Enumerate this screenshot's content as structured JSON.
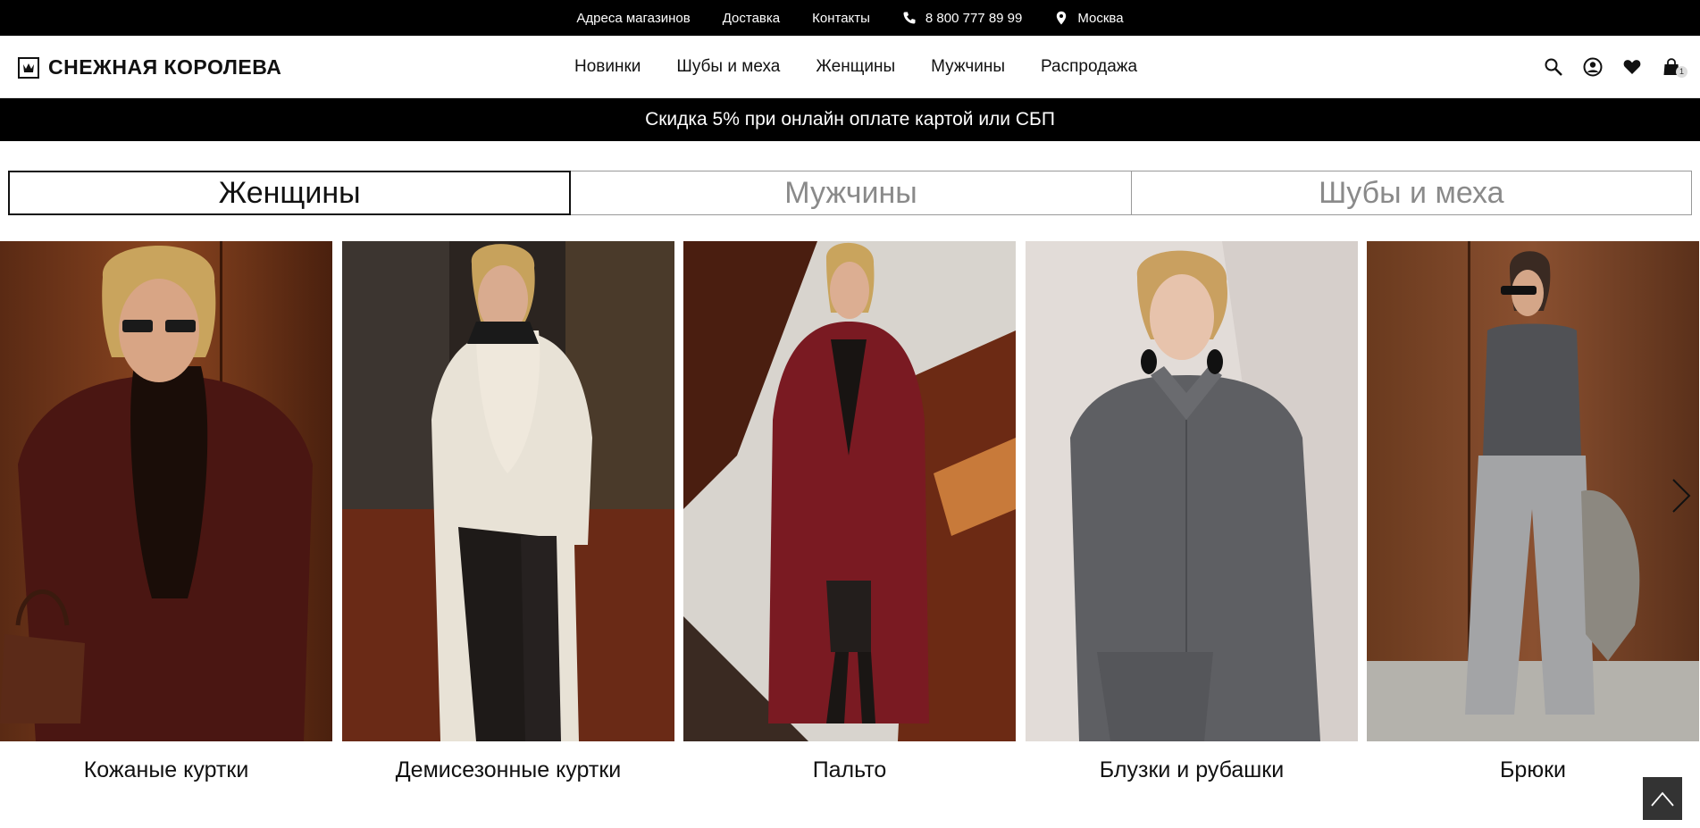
{
  "topbar": {
    "stores": "Адреса магазинов",
    "delivery": "Доставка",
    "contacts": "Контакты",
    "phone": "8 800 777 89 99",
    "city": "Москва"
  },
  "header": {
    "logo_text": "СНЕЖНАЯ КОРОЛЕВА",
    "nav": [
      "Новинки",
      "Шубы и меха",
      "Женщины",
      "Мужчины",
      "Распродажа"
    ],
    "cart_count": "1"
  },
  "promo": {
    "text": "Скидка 5% при онлайн оплате картой или СБП"
  },
  "tabs": [
    {
      "label": "Женщины",
      "active": true
    },
    {
      "label": "Мужчины",
      "active": false
    },
    {
      "label": "Шубы и меха",
      "active": false
    }
  ],
  "categories": [
    {
      "label": "Кожаные куртки"
    },
    {
      "label": "Демисезонные куртки"
    },
    {
      "label": "Пальто"
    },
    {
      "label": "Блузки и рубашки"
    },
    {
      "label": "Брюки"
    }
  ],
  "colors": {
    "topbar_bg": "#000000",
    "promo_bg": "#000000",
    "scroll_top_bg": "#333333"
  }
}
